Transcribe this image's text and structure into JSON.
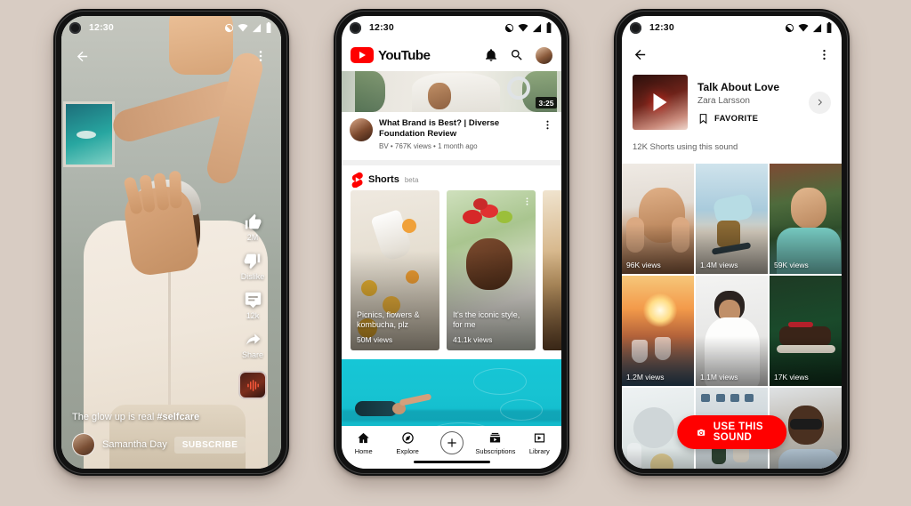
{
  "background_color": "#d8ccc3",
  "phone1": {
    "name": "shorts-player",
    "status_bar": {
      "time": "12:30",
      "icons": [
        "dnd-icon",
        "wifi-icon",
        "signal-icon",
        "battery-icon"
      ]
    },
    "top_bar": {
      "back": "back-arrow-icon",
      "more": "more-vertical-icon"
    },
    "rail": [
      {
        "icon": "thumbs-up-icon",
        "label": "2M"
      },
      {
        "icon": "thumbs-down-icon",
        "label": "Dislike"
      },
      {
        "icon": "comment-icon",
        "label": "12k"
      },
      {
        "icon": "share-icon",
        "label": "Share"
      }
    ],
    "sound_chip": "sound-wave-icon",
    "caption": "The glow up is real ",
    "caption_tag": "#selfcare",
    "channel": {
      "name": "Samantha Day",
      "subscribe_label": "SUBSCRIBE"
    }
  },
  "phone2": {
    "name": "youtube-home",
    "status_bar": {
      "time": "12:30"
    },
    "header": {
      "brand": "YouTube",
      "actions": [
        "bell-icon",
        "search-icon",
        "avatar"
      ]
    },
    "featured_video": {
      "duration": "3:25",
      "title": "What Brand is Best? | Diverse Foundation Review",
      "meta": "BV •  767K views • 1 month ago"
    },
    "shorts_shelf": {
      "label": "Shorts",
      "badge": "beta",
      "cards": [
        {
          "title": "Picnics, flowers & kombucha, plz",
          "views": "50M views"
        },
        {
          "title": "It's the iconic style, for me",
          "views": "41.1k views"
        },
        {
          "title": "",
          "views": ""
        }
      ]
    },
    "bottom_nav": [
      {
        "icon": "home-icon",
        "label": "Home"
      },
      {
        "icon": "compass-icon",
        "label": "Explore"
      },
      {
        "icon": "plus-icon",
        "label": ""
      },
      {
        "icon": "subscriptions-icon",
        "label": "Subscriptions"
      },
      {
        "icon": "library-icon",
        "label": "Library"
      }
    ]
  },
  "phone3": {
    "name": "sound-detail",
    "status_bar": {
      "time": "12:30"
    },
    "top_bar": {
      "back": "back-arrow-icon",
      "more": "more-vertical-icon"
    },
    "sound": {
      "title": "Talk About Love",
      "artist": "Zara Larsson",
      "favorite_label": "FAVORITE",
      "favorite_icon": "bookmark-icon",
      "next_icon": "chevron-right-icon"
    },
    "usage_count": "12K Shorts using this sound",
    "grid": [
      {
        "views": "96K views"
      },
      {
        "views": "1.4M views"
      },
      {
        "views": "59K views"
      },
      {
        "views": "1.2M views"
      },
      {
        "views": "1.1M views"
      },
      {
        "views": "17K views"
      },
      {
        "views": ""
      },
      {
        "views": ""
      },
      {
        "views": ""
      }
    ],
    "cta": {
      "label": "USE THIS SOUND",
      "icon": "camera-icon",
      "color": "#ff0000"
    }
  }
}
